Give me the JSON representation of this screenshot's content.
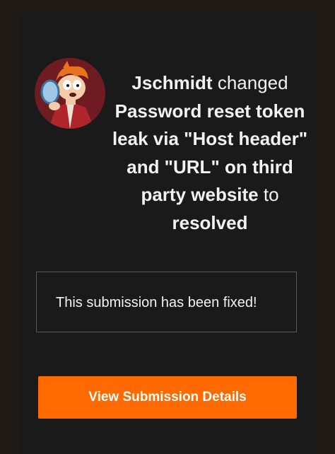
{
  "event": {
    "user": "Jschmidt",
    "verb": "changed",
    "submission_title": "Password reset token leak via \"Host header\" and \"URL\" on third party website",
    "connector": "to",
    "new_status": "resolved"
  },
  "notice": {
    "message": "This submission has been fixed!"
  },
  "action": {
    "button_label": "View Submission Details"
  },
  "colors": {
    "accent": "#ff6a00",
    "card_background": "#1a1a1a",
    "page_background": "#1f1a16",
    "text": "#f2f2f2",
    "notice_border": "#5a5a5a"
  },
  "icons": {
    "avatar": "user-avatar-cartoon-character"
  }
}
